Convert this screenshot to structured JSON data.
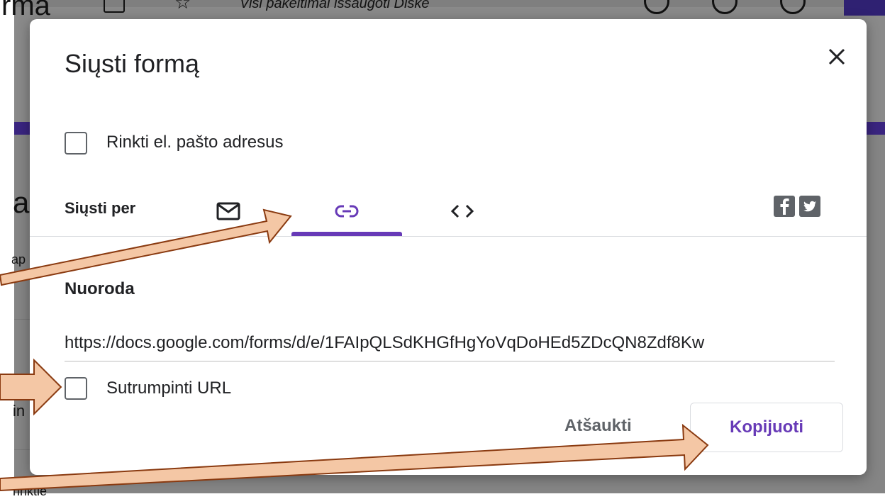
{
  "background": {
    "app_title_fragment": "rma",
    "top_info_fragment": "Visi pakeitimai išsaugoti Diske",
    "side_fragments": [
      "a",
      "ap",
      "in",
      "rinktie"
    ]
  },
  "dialog": {
    "title": "Siųsti formą",
    "collect_email_label": "Rinkti el. pašto adresus",
    "collect_email_checked": false,
    "send_via_label": "Siųsti per",
    "tabs": [
      {
        "name": "email",
        "icon": "mail-icon",
        "selected": false
      },
      {
        "name": "link",
        "icon": "link-icon",
        "selected": true
      },
      {
        "name": "embed",
        "icon": "code-icon",
        "selected": false
      }
    ],
    "social": [
      "facebook-icon",
      "twitter-icon"
    ],
    "link_section_title": "Nuoroda",
    "url": "https://docs.google.com/forms/d/e/1FAIpQLSdKHGfHgYoVqDoHEd5ZDcQN8Zdf8Kw",
    "shorten_label": "Sutrumpinti URL",
    "shorten_checked": false,
    "cancel_label": "Atšaukti",
    "copy_label": "Kopijuoti"
  },
  "colors": {
    "accent": "#673ab7",
    "text": "#202124",
    "muted": "#5f6368",
    "arrow_fill": "#f4c7a5",
    "arrow_stroke": "#8a3a10"
  }
}
